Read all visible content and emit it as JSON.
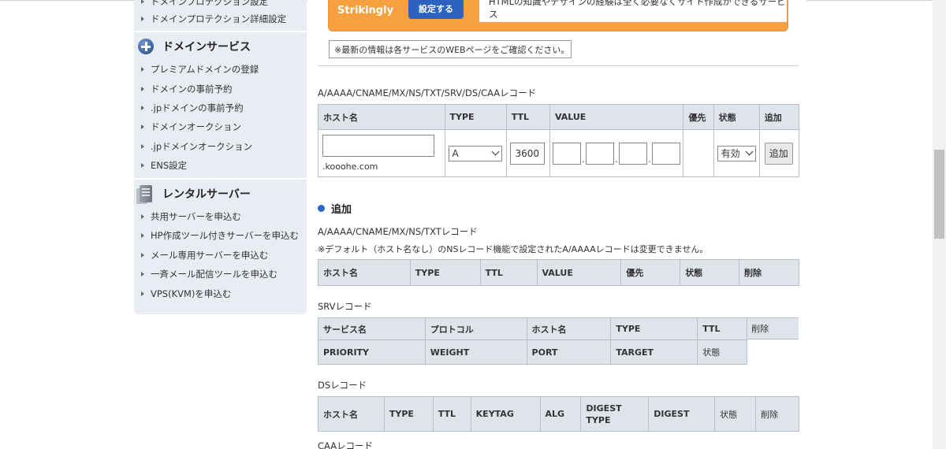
{
  "sidebar": {
    "top_items": [
      {
        "label": "ドメインプロテクション設定"
      },
      {
        "label": "ドメインプロテクション詳細設定"
      }
    ],
    "sections": [
      {
        "title": "ドメインサービス",
        "icon": "plus-circle-icon",
        "items": [
          {
            "label": "プレミアムドメインの登録"
          },
          {
            "label": "ドメインの事前予約"
          },
          {
            "label": ".jpドメインの事前予約"
          },
          {
            "label": "ドメインオークション"
          },
          {
            "label": ".jpドメインオークション"
          },
          {
            "label": "ENS設定"
          }
        ]
      },
      {
        "title": "レンタルサーバー",
        "icon": "server-icon",
        "items": [
          {
            "label": "共用サーバーを申込む"
          },
          {
            "label": "HP作成ツール付きサーバーを申込む"
          },
          {
            "label": "メール専用サーバーを申込む"
          },
          {
            "label": "一斉メール配信ツールを申込む"
          },
          {
            "label": "VPS(KVM)を申込む"
          }
        ]
      }
    ]
  },
  "banner": {
    "title": "Strikingly",
    "button_label": "設定する",
    "description": "HTMLの知識やデザインの経験は全く必要なくサイト作成ができるサービス"
  },
  "notice": "※最新の情報は各サービスのWEBページをご確認ください。",
  "record_form": {
    "label": "A/AAAA/CNAME/MX/NS/TXT/SRV/DS/CAAレコード",
    "headers": [
      "ホスト名",
      "TYPE",
      "TTL",
      "VALUE",
      "優先",
      "状態",
      "追加"
    ],
    "host_value": "",
    "domain_suffix": ".kooohe.com",
    "type_value": "A",
    "ttl_value": "3600",
    "status_value": "有効",
    "add_button": "追加"
  },
  "add_section": {
    "title": "追加",
    "a_records": {
      "label": "A/AAAA/CNAME/MX/NS/TXTレコード",
      "note": "※デフォルト（ホスト名なし）のNSレコード機能で設定されたA/AAAAレコードは変更できません。",
      "headers": [
        "ホスト名",
        "TYPE",
        "TTL",
        "VALUE",
        "優先",
        "状態",
        "削除"
      ]
    },
    "srv_records": {
      "label": "SRVレコード",
      "headers_row1": [
        "サービス名",
        "プロトコル",
        "ホスト名",
        "TYPE",
        "TTL",
        "削除"
      ],
      "headers_row2": [
        "PRIORITY",
        "WEIGHT",
        "PORT",
        "TARGET",
        "状態"
      ]
    },
    "ds_records": {
      "label": "DSレコード",
      "headers": [
        "ホスト名",
        "TYPE",
        "TTL",
        "KEYTAG",
        "ALG",
        "DIGEST TYPE",
        "DIGEST",
        "状態",
        "削除"
      ]
    },
    "caa_records": {
      "label": "CAAレコード"
    }
  },
  "colors": {
    "accent_blue": "#2a66c8",
    "banner_orange": "#f6a040",
    "sidebar_bg": "#e9edf3",
    "header_bg": "#dfe3ea"
  }
}
